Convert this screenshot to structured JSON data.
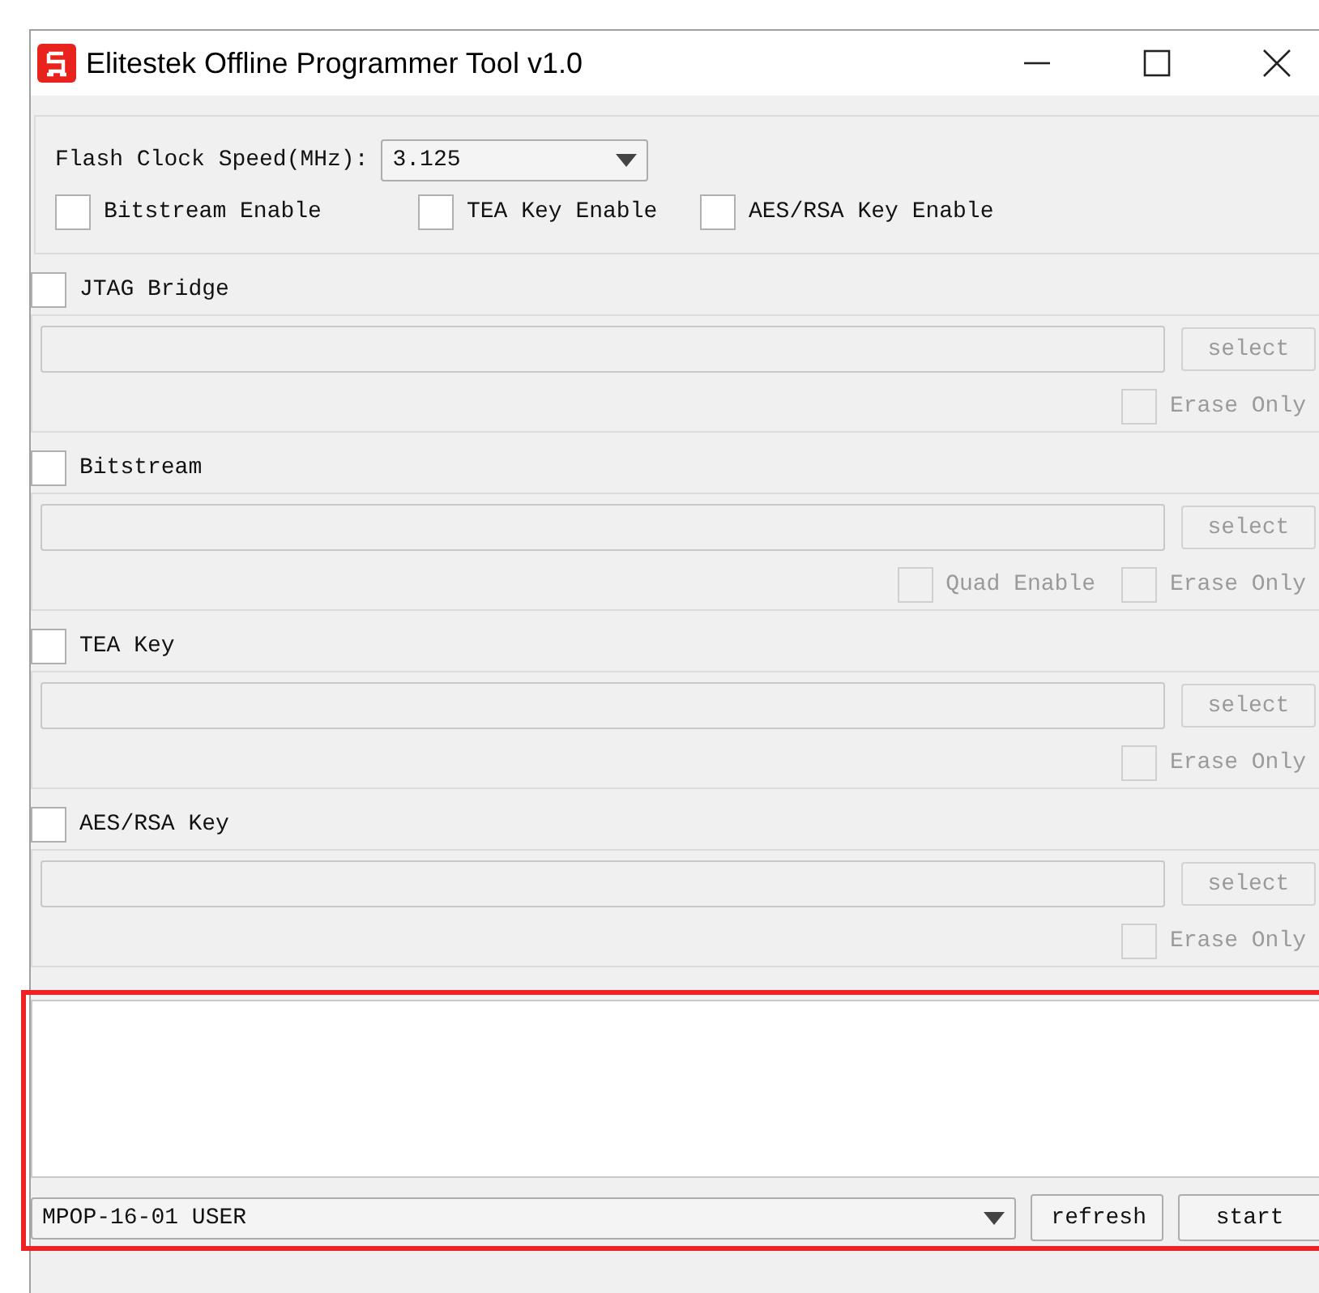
{
  "window": {
    "title": "Elitestek Offline Programmer Tool v1.0"
  },
  "settings": {
    "clock_label": "Flash Clock Speed(MHz):",
    "clock_value": "3.125",
    "options": [
      {
        "label": "Bitstream Enable",
        "checked": false
      },
      {
        "label": "TEA Key Enable",
        "checked": false
      },
      {
        "label": "AES/RSA Key Enable",
        "checked": false
      }
    ]
  },
  "sections": [
    {
      "title": "JTAG Bridge",
      "checked": false,
      "button": "select",
      "disabled": true,
      "options": [
        {
          "label": "Erase Only",
          "checked": false
        }
      ]
    },
    {
      "title": "Bitstream",
      "checked": false,
      "button": "select",
      "disabled": true,
      "options": [
        {
          "label": "Quad Enable",
          "checked": false
        },
        {
          "label": "Erase Only",
          "checked": false
        }
      ]
    },
    {
      "title": "TEA Key",
      "checked": false,
      "button": "select",
      "disabled": true,
      "options": [
        {
          "label": "Erase Only",
          "checked": false
        }
      ]
    },
    {
      "title": "AES/RSA Key",
      "checked": false,
      "button": "select",
      "disabled": true,
      "options": [
        {
          "label": "Erase Only",
          "checked": false
        }
      ]
    }
  ],
  "log": {
    "highlighted": true,
    "device": "MPOP-16-01 USER",
    "buttons": [
      "refresh",
      "start"
    ]
  }
}
